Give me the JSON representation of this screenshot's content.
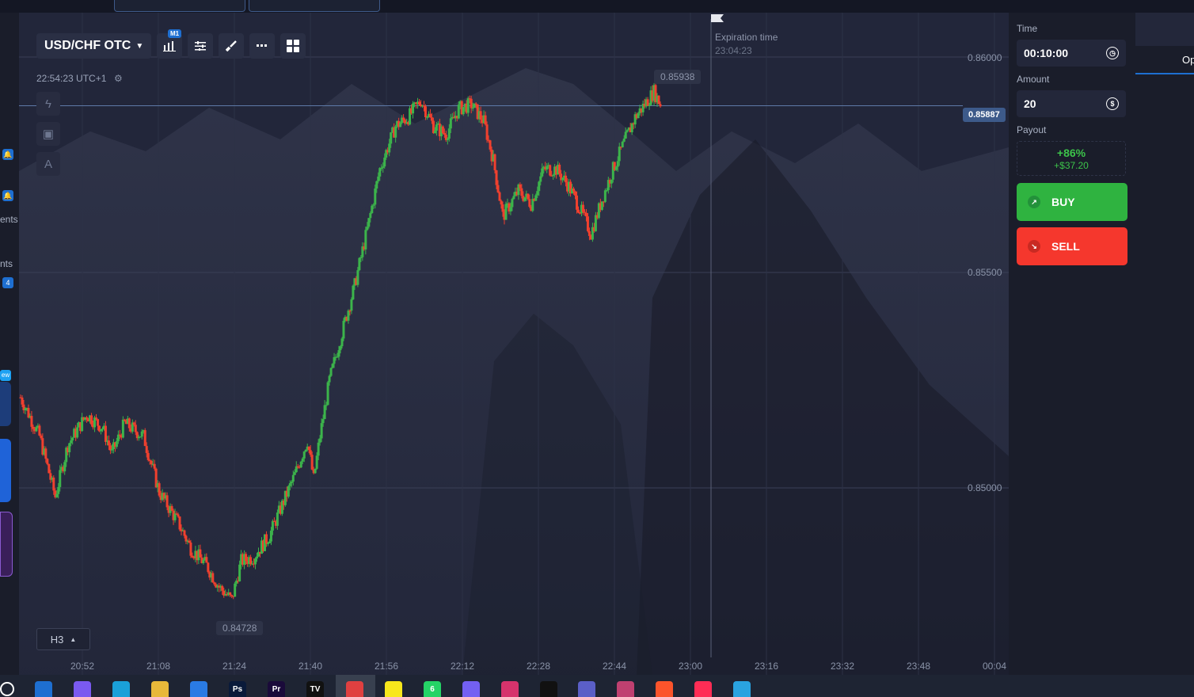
{
  "toolbar": {
    "asset": "USD/CHF OTC",
    "timeframe_badge": "M1",
    "chart_type_icon": "bar-chart-icon",
    "indicators_icon": "sliders-icon",
    "drawing_icon": "brush-icon",
    "more_icon": "dots-icon",
    "layout_icon": "grid-icon"
  },
  "clock": "22:54:23 UTC+1",
  "side_tools": [
    "lightning-icon",
    "gift-icon",
    "text-icon"
  ],
  "chart": {
    "current_price": "0.85887",
    "price_labels": [
      "0.86000",
      "0.85500",
      "0.85000"
    ],
    "high_label": "0.85938",
    "low_label": "0.84728",
    "expiration_title": "Expiration time",
    "expiration_value": "23:04:23",
    "timeframe": "H3",
    "time_labels": [
      "20:52",
      "21:08",
      "21:24",
      "21:40",
      "21:56",
      "22:12",
      "22:28",
      "22:44",
      "23:00",
      "23:16",
      "23:32",
      "23:48",
      "00:04"
    ]
  },
  "chart_data": {
    "type": "candlestick",
    "symbol": "USD/CHF OTC",
    "ylim": [
      0.847,
      0.8605
    ],
    "x_ticks": [
      "20:52",
      "21:08",
      "21:24",
      "21:40",
      "21:56",
      "22:12",
      "22:28",
      "22:44",
      "23:00",
      "23:16",
      "23:32",
      "23:48",
      "00:04"
    ],
    "y_ticks": [
      0.85,
      0.855,
      0.86
    ],
    "path_points": [
      [
        0,
        0.8521
      ],
      [
        12,
        0.8512
      ],
      [
        22,
        0.8498
      ],
      [
        30,
        0.851
      ],
      [
        42,
        0.8517
      ],
      [
        52,
        0.8514
      ],
      [
        58,
        0.8508
      ],
      [
        66,
        0.8515
      ],
      [
        78,
        0.8512
      ],
      [
        88,
        0.8499
      ],
      [
        100,
        0.8492
      ],
      [
        108,
        0.8486
      ],
      [
        118,
        0.8482
      ],
      [
        126,
        0.8477
      ],
      [
        134,
        0.8474
      ],
      [
        140,
        0.8483
      ],
      [
        148,
        0.8484
      ],
      [
        158,
        0.8489
      ],
      [
        166,
        0.8496
      ],
      [
        174,
        0.8503
      ],
      [
        182,
        0.8511
      ],
      [
        186,
        0.8502
      ],
      [
        190,
        0.8512
      ],
      [
        196,
        0.8525
      ],
      [
        204,
        0.8536
      ],
      [
        212,
        0.8547
      ],
      [
        220,
        0.856
      ],
      [
        228,
        0.8574
      ],
      [
        238,
        0.8584
      ],
      [
        246,
        0.8586
      ],
      [
        254,
        0.859
      ],
      [
        262,
        0.8584
      ],
      [
        270,
        0.8582
      ],
      [
        278,
        0.8588
      ],
      [
        286,
        0.8589
      ],
      [
        294,
        0.8585
      ],
      [
        300,
        0.8576
      ],
      [
        306,
        0.8563
      ],
      [
        316,
        0.8569
      ],
      [
        324,
        0.8566
      ],
      [
        332,
        0.8574
      ],
      [
        340,
        0.8574
      ],
      [
        348,
        0.857
      ],
      [
        356,
        0.8564
      ],
      [
        362,
        0.8559
      ],
      [
        370,
        0.8568
      ],
      [
        376,
        0.8574
      ],
      [
        384,
        0.8581
      ],
      [
        390,
        0.8586
      ],
      [
        396,
        0.8589
      ],
      [
        402,
        0.8592
      ],
      [
        406,
        0.8589
      ]
    ],
    "high": 0.85938,
    "low": 0.84728,
    "current": 0.85887
  },
  "right_panel": {
    "time_label": "Time",
    "time_value": "00:10:00",
    "amount_label": "Amount",
    "amount_value": "20",
    "payout_label": "Payout",
    "payout_percent": "+86%",
    "payout_amount": "+$37.20",
    "buy_label": "BUY",
    "sell_label": "SELL",
    "tab_partial": "Op"
  },
  "left_sidebar": {
    "text1": "ents",
    "text2": "nts",
    "badge_count": "4",
    "new_badge": "ew"
  },
  "taskbar": {
    "apps": [
      "search-icon",
      "outlook-icon",
      "copilot-icon",
      "edge-icon",
      "file-explorer-icon",
      "store-icon",
      "photoshop-icon",
      "premiere-icon",
      "tradingview-icon",
      "chrome-icon",
      "snapchat-icon",
      "whatsapp-icon",
      "viber-icon",
      "instagram-icon",
      "tiktok-icon",
      "teams-icon",
      "app-icon",
      "brave-icon",
      "youtube-music-icon",
      "telegram-icon"
    ],
    "labels": {
      "ps": "Ps",
      "pr": "Pr",
      "tv": "TV"
    },
    "whatsapp_count": "6"
  },
  "colors": {
    "bull": "#3cb44b",
    "bear": "#f0402e",
    "accent": "#1e6fd1"
  }
}
